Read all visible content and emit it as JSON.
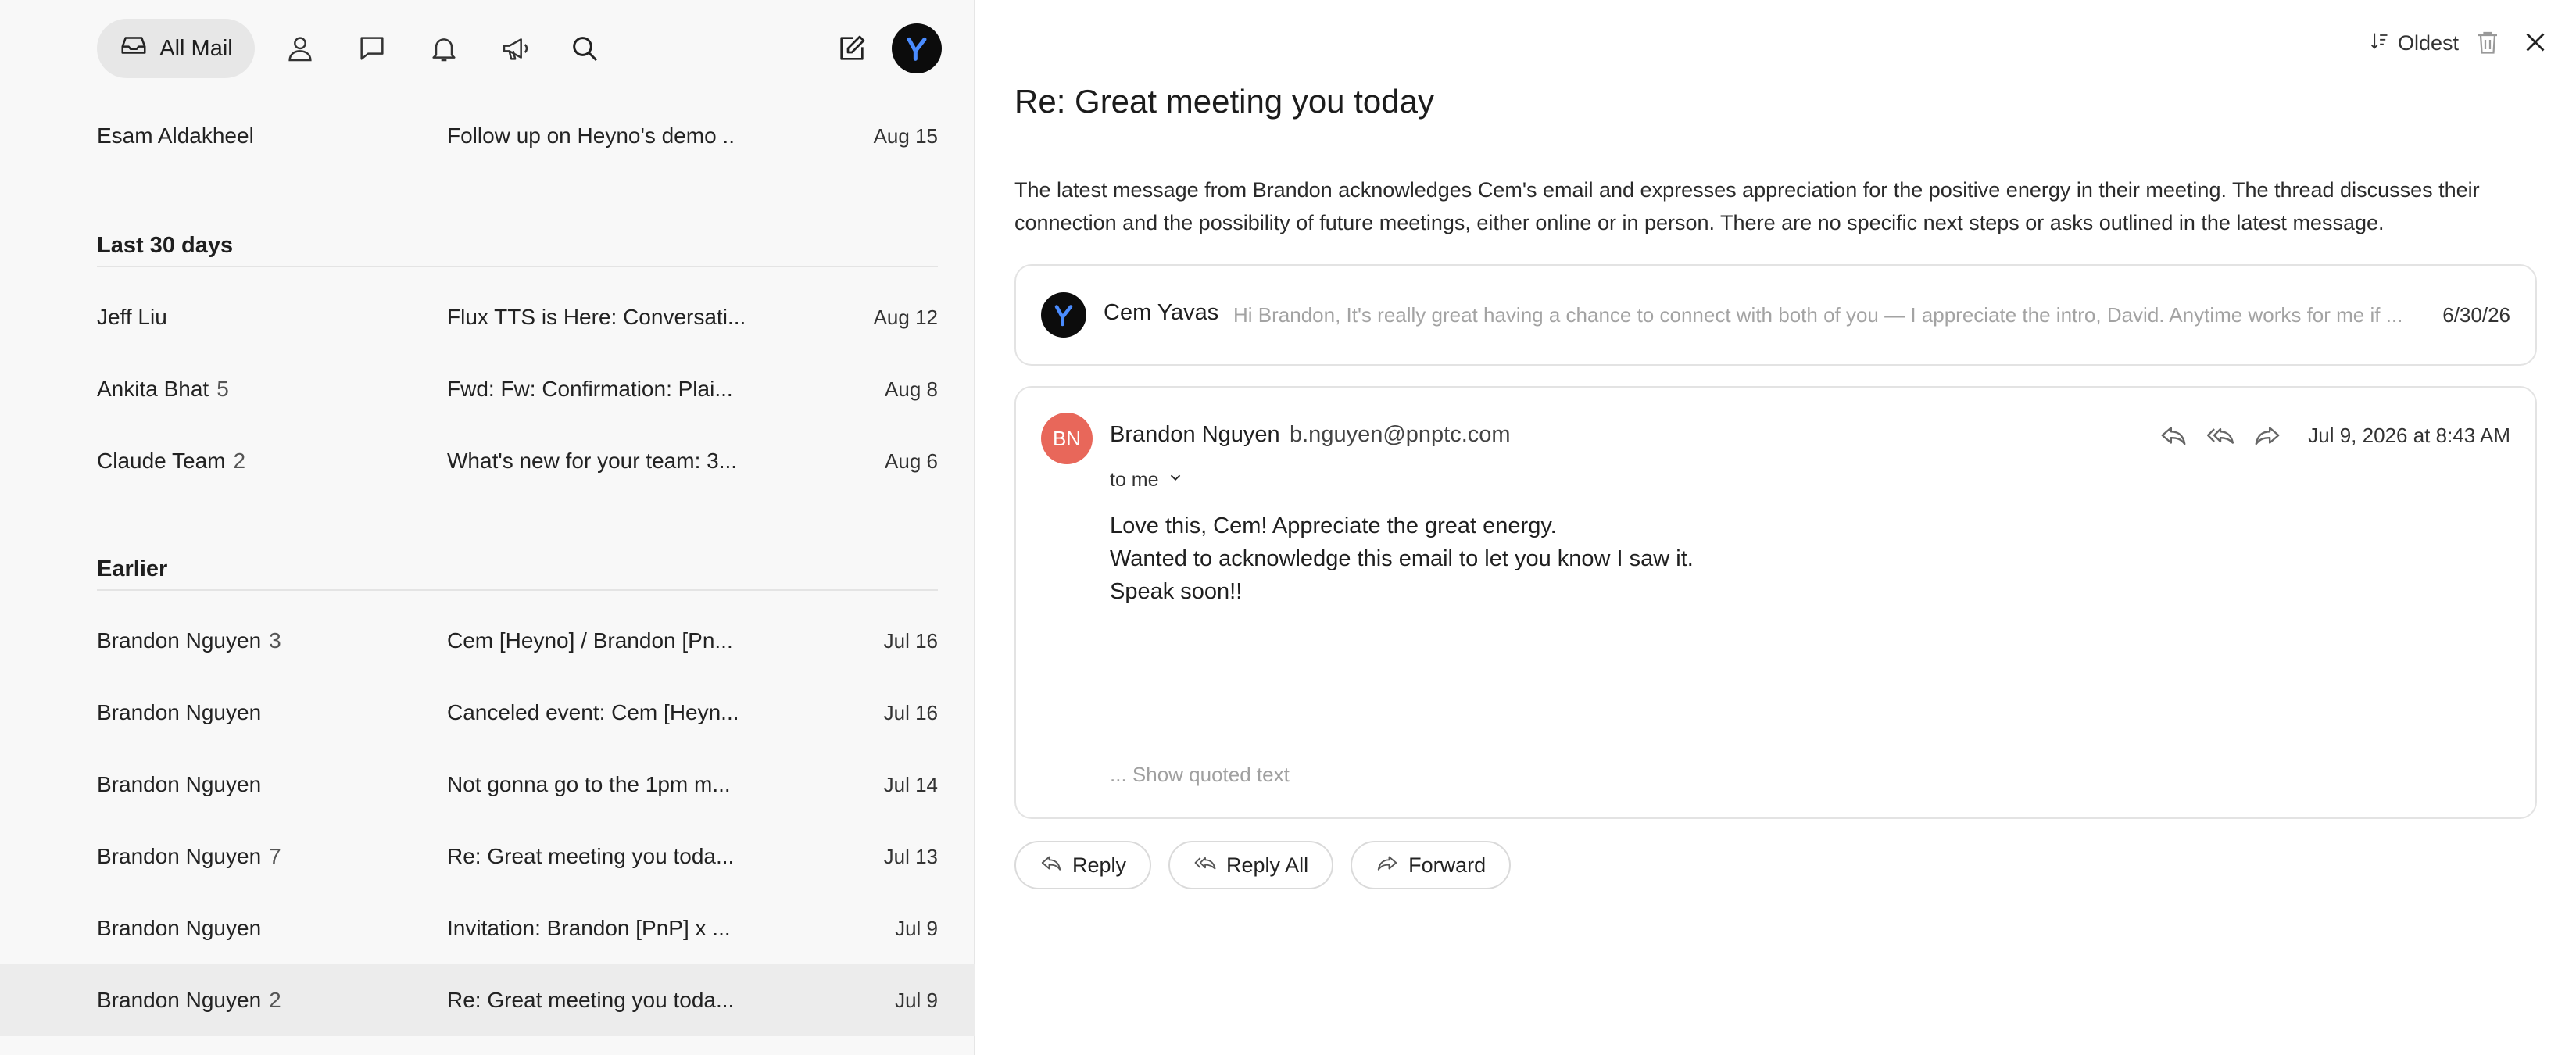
{
  "topbar": {
    "all_mail_label": "All Mail",
    "icons": [
      "inbox-icon",
      "person-icon",
      "chat-icon",
      "bell-icon",
      "megaphone-icon",
      "search-icon",
      "compose-icon"
    ],
    "avatar_letter": "Y"
  },
  "list": {
    "top_rows": [
      {
        "sender": "Esam Aldakheel",
        "count": "",
        "subject": "Follow up on Heyno's demo  ..",
        "date": "Aug 15"
      }
    ],
    "sections": [
      {
        "title": "Last 30 days",
        "rows": [
          {
            "sender": "Jeff Liu",
            "count": "",
            "subject": "Flux TTS is Here: Conversati...",
            "date": "Aug 12"
          },
          {
            "sender": "Ankita Bhat",
            "count": "5",
            "subject": "Fwd: Fw: Confirmation: Plai...",
            "date": "Aug 8"
          },
          {
            "sender": "Claude Team",
            "count": "2",
            "subject": "What's new for your team: 3...",
            "date": "Aug 6"
          }
        ]
      },
      {
        "title": "Earlier",
        "rows": [
          {
            "sender": "Brandon Nguyen",
            "count": "3",
            "subject": "Cem [Heyno] / Brandon [Pn...",
            "date": "Jul 16"
          },
          {
            "sender": "Brandon Nguyen",
            "count": "",
            "subject": "Canceled event: Cem [Heyn...",
            "date": "Jul 16"
          },
          {
            "sender": "Brandon Nguyen",
            "count": "",
            "subject": "Not gonna go to the 1pm m...",
            "date": "Jul 14"
          },
          {
            "sender": "Brandon Nguyen",
            "count": "7",
            "subject": "Re: Great meeting you toda...",
            "date": "Jul 13"
          },
          {
            "sender": "Brandon Nguyen",
            "count": "",
            "subject": "Invitation: Brandon [PnP] x ...",
            "date": "Jul 9"
          },
          {
            "sender": "Brandon Nguyen",
            "count": "2",
            "subject": "Re: Great meeting you toda...",
            "date": "Jul 9",
            "selected": true
          }
        ]
      }
    ]
  },
  "thread": {
    "sort_label": "Oldest",
    "title": "Re: Great meeting you today",
    "summary": "The latest message from Brandon acknowledges Cem's email and expresses appreciation for the positive energy in their meeting. The thread discusses their connection and the possibility of future meetings, either online or in person. There are no specific next steps or asks outlined in the latest message.",
    "collapsed_message": {
      "avatar_letter": "Y",
      "name": "Cem Yavas",
      "snippet": "Hi Brandon, It's really great having a chance to connect with both of you — I appreciate the intro, David. Anytime works for me if ...",
      "date": "6/30/26"
    },
    "expanded_message": {
      "initials": "BN",
      "name": "Brandon Nguyen",
      "email": "b.nguyen@pnptc.com",
      "date": "Jul 9, 2026 at 8:43 AM",
      "to": "to me",
      "body_lines": [
        "Love this, Cem! Appreciate the great energy.",
        "Wanted to acknowledge this email to let you know I saw it.",
        "Speak soon!!"
      ],
      "show_quoted": "... Show quoted text"
    },
    "actions": {
      "reply": "Reply",
      "reply_all": "Reply All",
      "forward": "Forward"
    }
  },
  "colors": {
    "left_bg": "#f8f8f8",
    "selected_row": "#ececec",
    "avatar_bn": "#e8675a",
    "avatar_y_bg": "#0c0c0c",
    "avatar_y_letter": "#4a8cff"
  }
}
